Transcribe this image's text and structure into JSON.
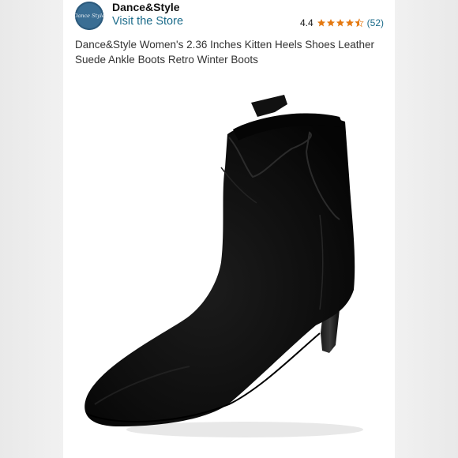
{
  "store": {
    "logo_text": "Dance Style",
    "name": "Dance&Style",
    "link_label": "Visit the Store"
  },
  "rating": {
    "value": "4.4",
    "stars_out_of_5": 4.4,
    "reviews": "(52)",
    "star_color": "#e47911"
  },
  "product": {
    "title": "Dance&Style Women's 2.36 Inches Kitten Heels Shoes Leather Suede Ankle Boots Retro Winter Boots",
    "image_icon": "black-suede-ankle-boot"
  },
  "colors": {
    "link": "#1b6b8a",
    "logo_bg": "#3a6e94"
  }
}
